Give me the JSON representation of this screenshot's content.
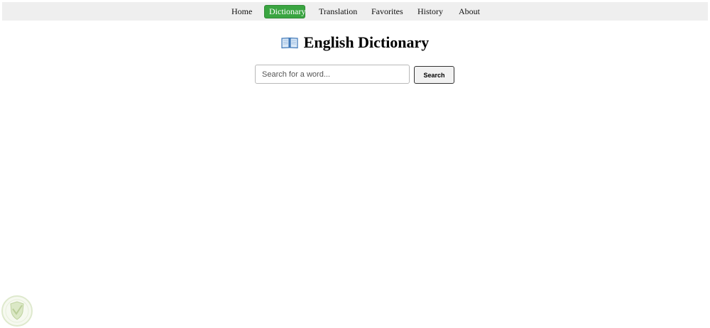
{
  "nav": {
    "items": [
      {
        "label": "Home"
      },
      {
        "label": "Dictionary",
        "active": true
      },
      {
        "label": "Translation"
      },
      {
        "label": "Favorites"
      },
      {
        "label": "History"
      },
      {
        "label": "About"
      }
    ],
    "active_color": "#3aa541"
  },
  "header": {
    "icon": "open-book-icon",
    "title": "English Dictionary"
  },
  "search": {
    "placeholder": "Search for a word...",
    "value": "",
    "button_label": "Search"
  },
  "watermark": {
    "icon": "shield-logo"
  }
}
